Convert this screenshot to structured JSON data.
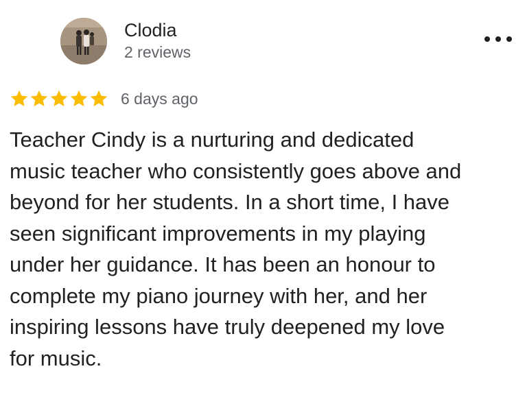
{
  "reviewer": {
    "name": "Clodia",
    "review_count": "2 reviews",
    "avatar_icon": "profile-photo-icon"
  },
  "menu": {
    "icon": "more-options-icon"
  },
  "rating": {
    "stars": 5,
    "max_stars": 5,
    "star_color": "#fbbc04",
    "date": "6 days ago"
  },
  "review": {
    "text": "Teacher Cindy is a nurturing and dedicated\nmusic teacher who consistently goes above and\nbeyond for her students. In a short time, I have\nseen significant improvements in my playing\nunder her guidance. It has been an honour to\ncomplete my piano journey with her, and her\ninspiring lessons have truly deepened my love\nfor music."
  }
}
